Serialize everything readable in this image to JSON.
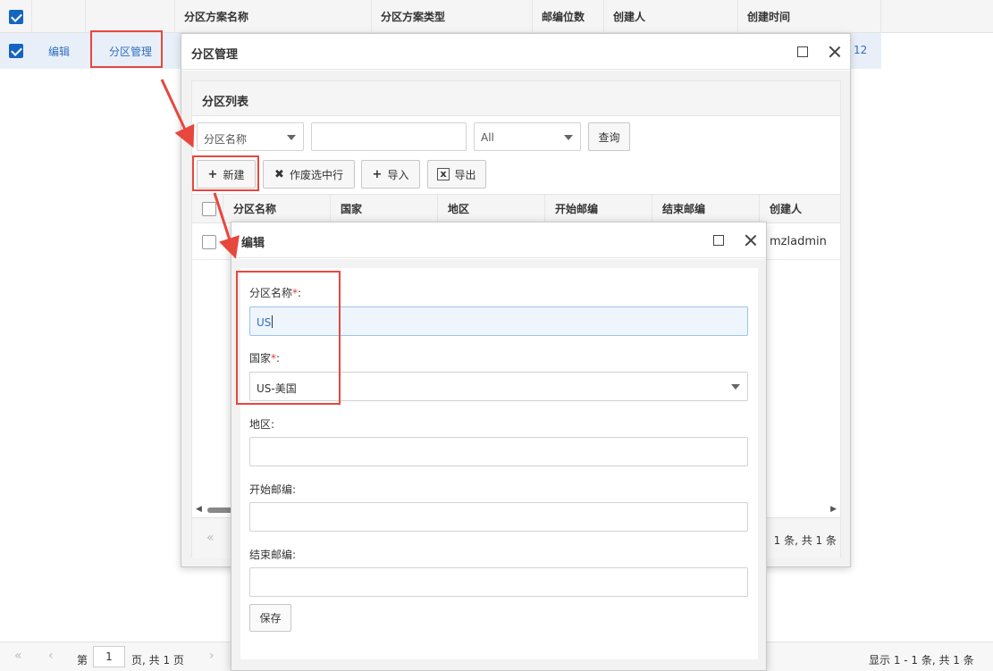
{
  "grid": {
    "columns": [
      "分区方案名称",
      "分区方案类型",
      "邮编位数",
      "创建人",
      "创建时间"
    ],
    "row": {
      "edit_link": "编辑",
      "manage_link": "分区管理",
      "trailing": "12"
    }
  },
  "pager": {
    "page_prefix": "第",
    "page_value": "1",
    "page_suffix": "页, 共 1 页",
    "summary": "显示 1 - 1 条, 共 1 条"
  },
  "win_manage": {
    "title": "分区管理",
    "panel_title": "分区列表",
    "filter_field": "分区名称",
    "filter_option": "All",
    "query_button": "查询",
    "toolbar": {
      "new": "新建",
      "void": "作废选中行",
      "import": "导入",
      "export": "导出"
    },
    "columns": [
      "分区名称",
      "国家",
      "地区",
      "开始邮编",
      "结束邮编",
      "创建人"
    ],
    "row": {
      "creator": "mzladmin"
    },
    "pager_summary": "1 条, 共 1 条"
  },
  "win_edit": {
    "title": "编辑",
    "fields": {
      "name_label": "分区名称",
      "name_value": "US",
      "country_label": "国家",
      "country_value": "US-美国",
      "region_label": "地区:",
      "start_label": "开始邮编:",
      "end_label": "结束邮编:"
    },
    "required_mark": "*",
    "label_colon": ":",
    "save_button": "保存"
  },
  "colors": {
    "accent": "#1565c0",
    "link": "#2f6fbf",
    "annotation": "#e8473d",
    "required": "#e53935"
  }
}
